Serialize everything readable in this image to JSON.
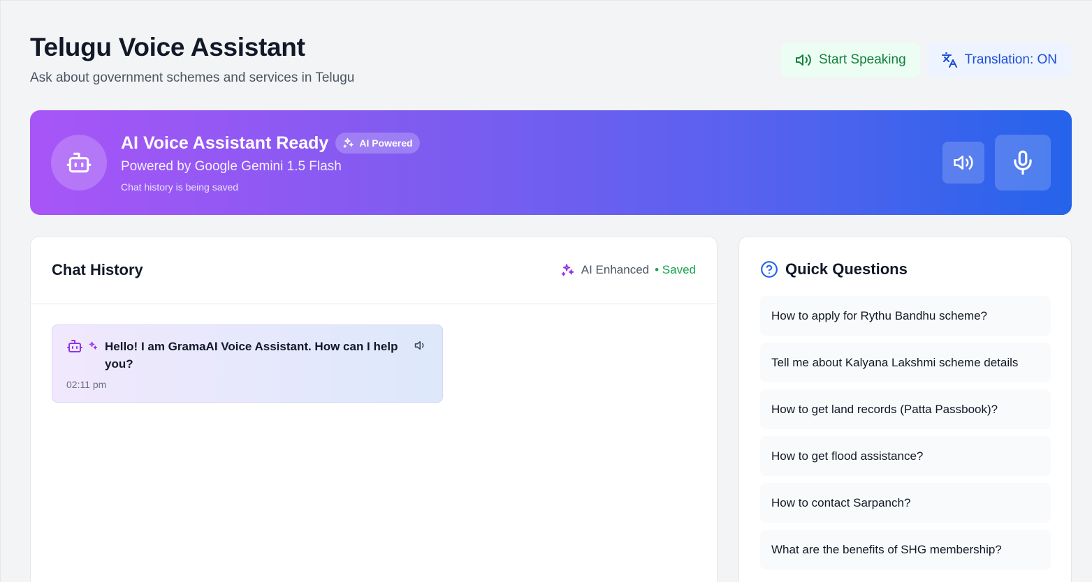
{
  "header": {
    "title": "Telugu Voice Assistant",
    "subtitle": "Ask about government schemes and services in Telugu"
  },
  "actions": {
    "start_speaking": "Start Speaking",
    "translation": "Translation: ON"
  },
  "banner": {
    "title": "AI Voice Assistant Ready",
    "badge": "AI Powered",
    "subtitle": "Powered by Google Gemini 1.5 Flash",
    "note": "Chat history is being saved"
  },
  "chat": {
    "title": "Chat History",
    "status_label": "AI Enhanced",
    "saved_label": "• Saved",
    "messages": [
      {
        "text": "Hello! I am GramaAI Voice Assistant. How can I help you?",
        "time": "02:11 pm"
      }
    ]
  },
  "quick_questions": {
    "title": "Quick Questions",
    "items": [
      "How to apply for Rythu Bandhu scheme?",
      "Tell me about Kalyana Lakshmi scheme details",
      "How to get land records (Patta Passbook)?",
      "How to get flood assistance?",
      "How to contact Sarpanch?",
      "What are the benefits of SHG membership?"
    ]
  },
  "colors": {
    "accent_purple": "#a855f7",
    "accent_blue": "#2563eb",
    "success_green": "#16a34a"
  },
  "icons": {
    "speaker": "speaker-icon",
    "translate": "translate-icon",
    "bot": "bot-icon",
    "sparkles": "sparkles-icon",
    "mic": "microphone-icon",
    "help": "help-circle-icon"
  }
}
